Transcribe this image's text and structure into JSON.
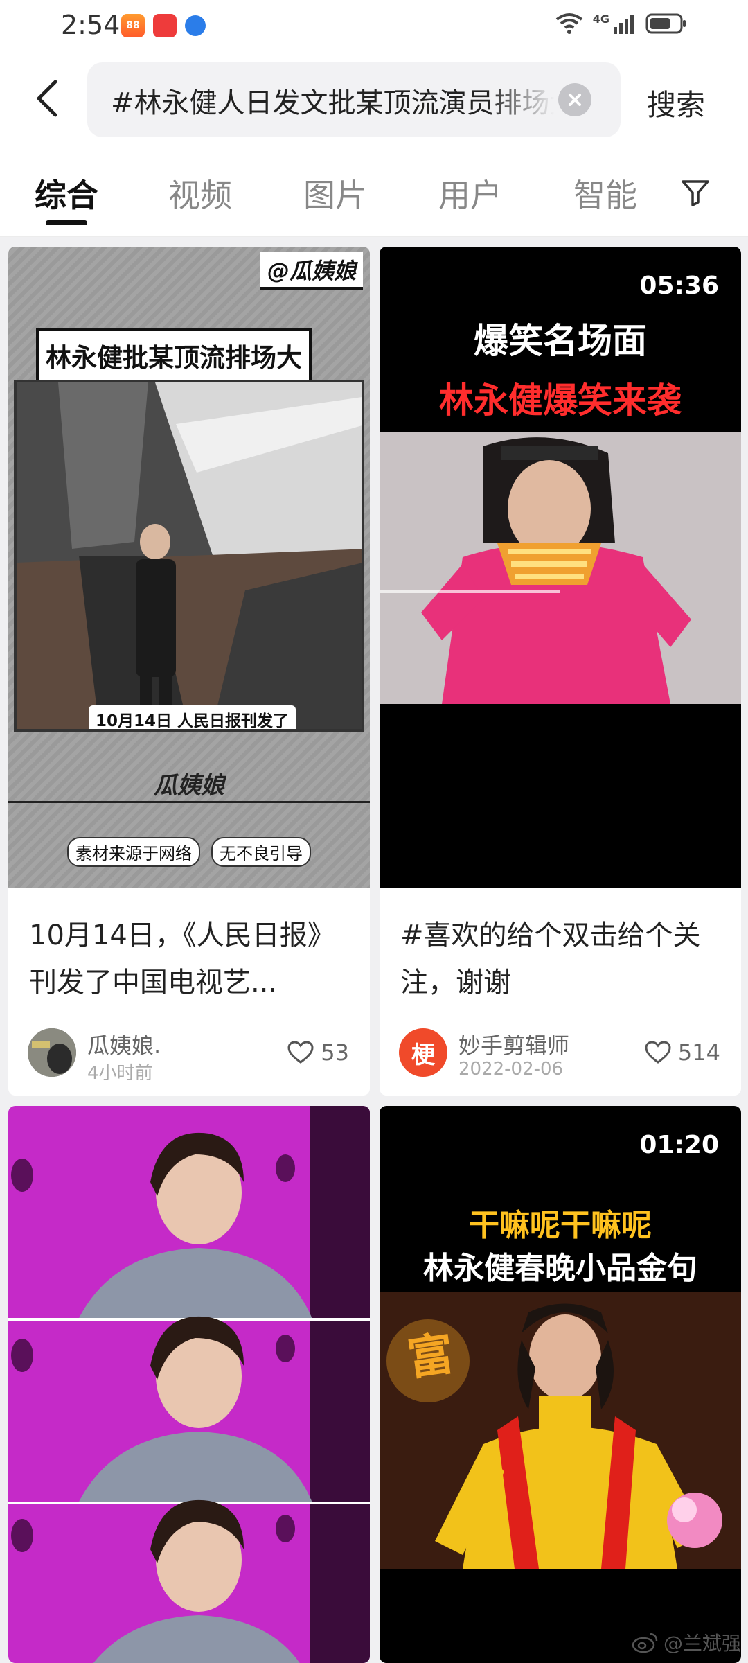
{
  "status": {
    "time": "2:54",
    "network": "4G"
  },
  "search": {
    "query": "#林永健人日发文批某顶流演员排场大",
    "submit_label": "搜索"
  },
  "tabs": [
    {
      "label": "综合",
      "active": true
    },
    {
      "label": "视频",
      "active": false
    },
    {
      "label": "图片",
      "active": false
    },
    {
      "label": "用户",
      "active": false
    },
    {
      "label": "智能",
      "active": false
    }
  ],
  "cards": [
    {
      "thumb_handle": "@瓜姨娘",
      "thumb_headline": "林永健批某顶流排场大",
      "thumb_caption": "10月14日 人民日报刊发了",
      "thumb_brand": "瓜姨娘",
      "thumb_tags": [
        "素材来源于网络",
        "无不良引导"
      ],
      "title": "10月14日，《人民日报》刊发了中国电视艺...",
      "author": "瓜姨娘.",
      "time": "4小时前",
      "likes": "53"
    },
    {
      "duration": "05:36",
      "thumb_line1": "爆笑名场面",
      "thumb_line2": "林永健爆笑来袭",
      "title": "#喜欢的给个双击给个关注，谢谢",
      "author": "妙手剪辑师",
      "avatar_char": "梗",
      "time": "2022-02-06",
      "likes": "514"
    },
    {
      "duration": "01:20",
      "thumb_line1": "干嘛呢干嘛呢",
      "thumb_line2": "林永健春晚小品金句",
      "thumb_sign": "富"
    }
  ],
  "watermark": "@兰斌强",
  "colors": {
    "accent_red": "#ff2d2d",
    "accent_yellow": "#ffc21f",
    "tab_active": "#111111"
  }
}
